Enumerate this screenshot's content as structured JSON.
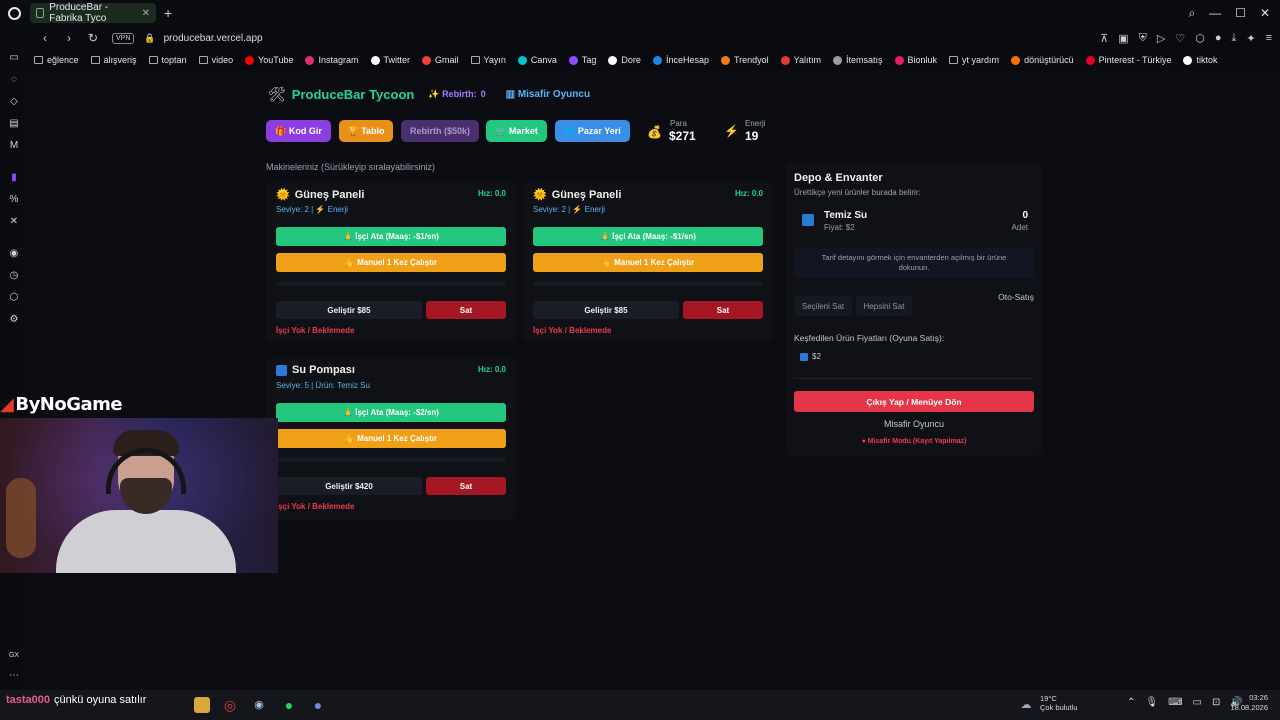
{
  "browser": {
    "tab_title": "ProduceBar - Fabrika Tyco",
    "url": "producebar.vercel.app",
    "vpn_label": "VPN",
    "bookmarks": [
      {
        "label": "eğlence",
        "icon": "folder-icon"
      },
      {
        "label": "alışveriş",
        "icon": "folder-icon"
      },
      {
        "label": "toptan",
        "icon": "folder-icon"
      },
      {
        "label": "video",
        "icon": "folder-icon"
      },
      {
        "label": "YouTube",
        "icon": "youtube-icon",
        "color": "#ff0000"
      },
      {
        "label": "Instagram",
        "icon": "instagram-icon",
        "color": "#e1306c"
      },
      {
        "label": "Twitter",
        "icon": "x-icon",
        "color": "#ffffff"
      },
      {
        "label": "Gmail",
        "icon": "gmail-icon",
        "color": "#ea4335"
      },
      {
        "label": "Yayın",
        "icon": "folder-icon"
      },
      {
        "label": "Canva",
        "icon": "canva-icon",
        "color": "#00c4cc"
      },
      {
        "label": "Tag",
        "icon": "tag-icon",
        "color": "#9146ff"
      },
      {
        "label": "Dore",
        "icon": "dore-icon",
        "color": "#ffffff"
      },
      {
        "label": "İnceHesap",
        "icon": "incehesap-icon",
        "color": "#1e88e5"
      },
      {
        "label": "Trendyol",
        "icon": "trendyol-icon",
        "color": "#f27a1a"
      },
      {
        "label": "Yalıtım",
        "icon": "yalitim-icon",
        "color": "#e53935"
      },
      {
        "label": "İtemsatış",
        "icon": "itemsatis-icon",
        "color": "#9e9e9e"
      },
      {
        "label": "Bionluk",
        "icon": "bionluk-icon",
        "color": "#e91e63"
      },
      {
        "label": "yt yardım",
        "icon": "folder-icon"
      },
      {
        "label": "dönüştürücü",
        "icon": "converter-icon",
        "color": "#ff6f00"
      },
      {
        "label": "Pinterest - Türkiye",
        "icon": "pinterest-icon",
        "color": "#e60023"
      },
      {
        "label": "tiktok",
        "icon": "tiktok-icon",
        "color": "#ffffff"
      }
    ]
  },
  "game": {
    "title": "ProduceBar Tycoon",
    "rebirth_label": "Rebirth:",
    "rebirth_count": "0",
    "player_name": "Misafir Oyuncu",
    "buttons": {
      "code": "Kod Gir",
      "table": "Tablo",
      "rebirth": "Rebirth ($50k)",
      "market": "Market",
      "bazaar": "Pazar Yeri"
    },
    "colors": {
      "accent": "#22d39a",
      "code_btn": "#8b3fe0",
      "table_btn": "#e8901a",
      "rebirth_btn": "#4a2f6e",
      "market_btn": "#23c77e",
      "bazaar_btn": "#3a8ee6"
    },
    "stats": {
      "money_label": "Para",
      "money_value": "$271",
      "energy_label": "Enerji",
      "energy_value": "19"
    },
    "machines_label": "Makineleriniz (Sürükleyip sıralayabilirsiniz)",
    "machines": [
      {
        "name": "Güneş Paneli",
        "speed": "Hız: 0.0",
        "level": "Seviye: 2 | ⚡ Enerji",
        "assign": "İşçi Ata (Maaş: -$1/sn)",
        "manual": "Manuel 1 Kez Çalıştır",
        "upgrade": "Geliştir $85",
        "sell": "Sat",
        "status": "İşçi Yok / Beklemede"
      },
      {
        "name": "Güneş Paneli",
        "speed": "Hız: 0.0",
        "level": "Seviye: 2 | ⚡ Enerji",
        "assign": "İşçi Ata (Maaş: -$1/sn)",
        "manual": "Manuel 1 Kez Çalıştır",
        "upgrade": "Geliştir $85",
        "sell": "Sat",
        "status": "İşçi Yok / Beklemede"
      },
      {
        "name": "Su Pompası",
        "speed": "Hız: 0.0",
        "level": "Seviye: 5 | Ürün: Temiz Su",
        "assign": "İşçi Ata (Maaş: -$2/sn)",
        "manual": "Manuel 1 Kez Çalıştır",
        "upgrade": "Geliştir $420",
        "sell": "Sat",
        "status": "İşçi Yok / Beklemede"
      }
    ],
    "depot": {
      "title": "Depo & Envanter",
      "subtitle": "Ürettikçe yeni ürünler burada belirir:",
      "item_name": "Temiz Su",
      "item_price": "Fiyat: $2",
      "item_count": "0",
      "item_unit": "Adet",
      "recipe_hint": "Tarif detayını görmek için envanterden açılmış bir ürüne dokunun.",
      "sell_selected": "Seçileni Sat",
      "sell_all": "Hepsini Sat",
      "auto_sell": "Oto-Satış",
      "prices_label": "Keşfedilen Ürün Fiyatları (Oyuna Satış):",
      "price_chip": "$2",
      "logout": "Çıkış Yap / Menüye Dön",
      "user": "Misafir Oyuncu",
      "guest_mode": "Misafir Modu (Kayıt Yapılmaz)"
    }
  },
  "overlay": {
    "channel": "ByNoGame",
    "chat_user": "tasta000",
    "chat_message": "çünkü oyuna satılır"
  },
  "system": {
    "temperature": "19°C",
    "weather": "Çok bulutlu",
    "time": "03:26",
    "date": "18.08.2026"
  }
}
